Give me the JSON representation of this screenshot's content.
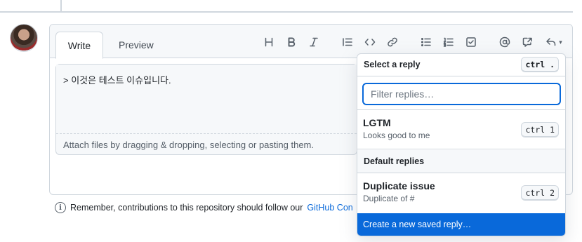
{
  "editor": {
    "tabs": {
      "write": "Write",
      "preview": "Preview"
    },
    "toolbar": [
      {
        "name": "heading-icon",
        "glyph": "H"
      },
      {
        "name": "bold-icon",
        "glyph": "B"
      },
      {
        "name": "italic-icon",
        "glyph": "I"
      },
      {
        "name": "quote-icon",
        "glyph": ""
      },
      {
        "name": "code-icon",
        "glyph": ""
      },
      {
        "name": "link-icon",
        "glyph": ""
      },
      {
        "name": "unordered-list-icon",
        "glyph": ""
      },
      {
        "name": "ordered-list-icon",
        "glyph": ""
      },
      {
        "name": "task-list-icon",
        "glyph": ""
      },
      {
        "name": "mention-icon",
        "glyph": ""
      },
      {
        "name": "cross-reference-icon",
        "glyph": ""
      },
      {
        "name": "saved-replies-icon",
        "glyph": ""
      }
    ],
    "text": "> 이것은 테스트 이슈입니다.",
    "attach_text": "Attach files by dragging & dropping, selecting or pasting them."
  },
  "notice": {
    "text": "Remember, contributions to this repository should follow our",
    "link": "GitHub Con"
  },
  "saved_replies": {
    "title": "Select a reply",
    "shortcut": "ctrl .",
    "filter_placeholder": "Filter replies…",
    "items": [
      {
        "title": "LGTM",
        "subtitle": "Looks good to me",
        "shortcut": "ctrl 1"
      }
    ],
    "section_title": "Default replies",
    "default_items": [
      {
        "title": "Duplicate issue",
        "subtitle": "Duplicate of #",
        "shortcut": "ctrl 2"
      }
    ],
    "create_label": "Create a new saved reply…"
  },
  "colors": {
    "accent": "#0969da",
    "border": "#d0d7de",
    "muted": "#57606a"
  }
}
